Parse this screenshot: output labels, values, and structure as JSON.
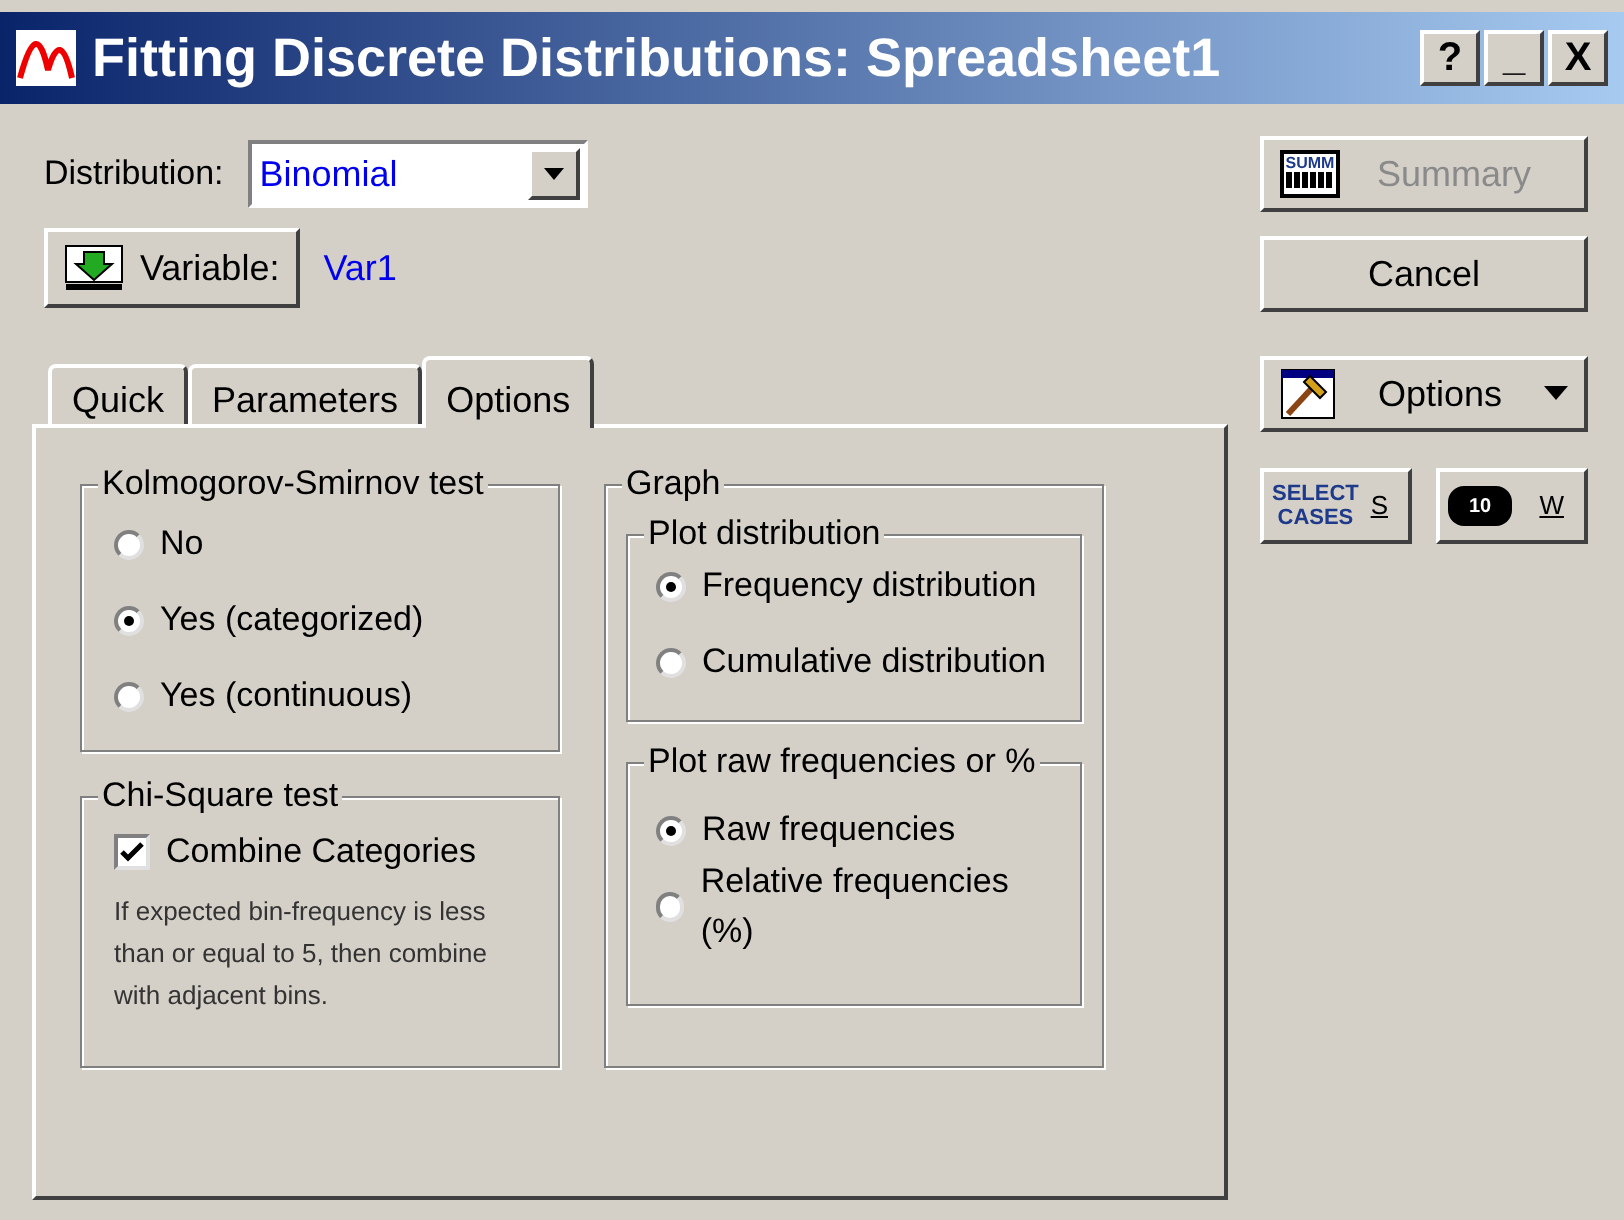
{
  "window": {
    "title": "Fitting Discrete Distributions: Spreadsheet1",
    "controls": [
      "?",
      "_",
      "X"
    ]
  },
  "distribution": {
    "label": "Distribution:",
    "value": "Binomial"
  },
  "variable": {
    "button": "Variable:",
    "value": "Var1"
  },
  "tabs": [
    {
      "label": "Quick",
      "selected": false
    },
    {
      "label": "Parameters",
      "selected": false
    },
    {
      "label": "Options",
      "selected": true
    }
  ],
  "ks_test": {
    "title": "Kolmogorov-Smirnov test",
    "options": [
      {
        "label": "No",
        "selected": false
      },
      {
        "label": "Yes (categorized)",
        "selected": true
      },
      {
        "label": "Yes (continuous)",
        "selected": false
      }
    ]
  },
  "chi_square": {
    "title": "Chi-Square test",
    "checkbox": {
      "label": "Combine Categories",
      "checked": true
    },
    "note": "If expected bin-frequency is less than or equal to 5, then combine with adjacent bins."
  },
  "graph": {
    "title": "Graph",
    "groups": [
      {
        "title": "Plot distribution",
        "options": [
          {
            "label": "Frequency distribution",
            "selected": true
          },
          {
            "label": "Cumulative distribution",
            "selected": false
          }
        ]
      },
      {
        "title": "Plot raw frequencies or %",
        "options": [
          {
            "label": "Raw frequencies",
            "selected": true
          },
          {
            "label": "Relative frequencies (%)",
            "selected": false
          }
        ]
      }
    ]
  },
  "buttons": [
    {
      "kind": "summary",
      "label": "Summary",
      "icon_text": "SUMM",
      "disabled": true
    },
    {
      "kind": "plain",
      "label": "Cancel",
      "disabled": false
    },
    {
      "kind": "options",
      "label": "Options",
      "disabled": false
    }
  ],
  "small_buttons": [
    {
      "kind": "select",
      "icon_text": [
        "SELECT",
        "CASES"
      ],
      "label": "S"
    },
    {
      "kind": "weight",
      "icon_text": "10",
      "label": "W"
    }
  ]
}
